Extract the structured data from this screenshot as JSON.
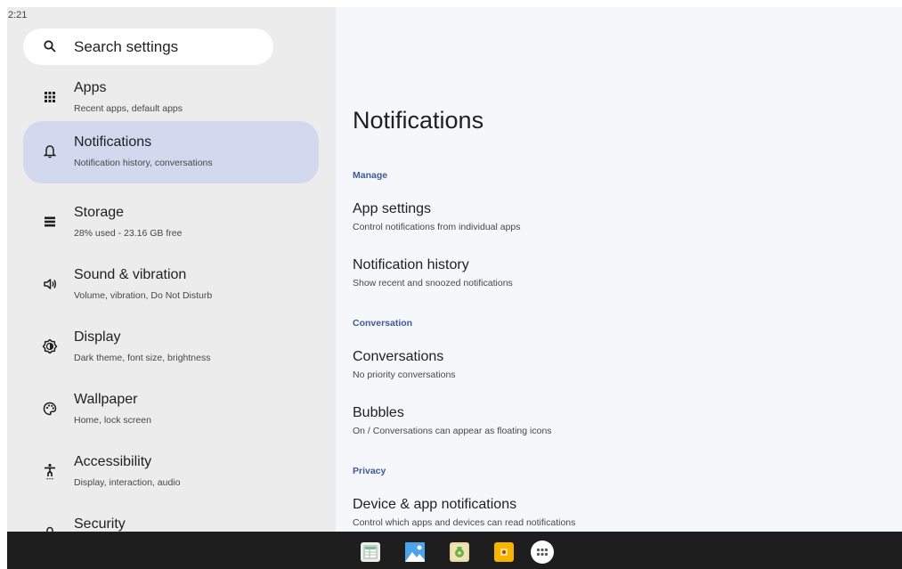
{
  "status_bar": {
    "time": "2:21"
  },
  "search": {
    "label": "Search settings",
    "icon": "search-icon"
  },
  "sidebar": {
    "items": [
      {
        "title": "Apps",
        "subtitle": "Recent apps, default apps",
        "icon": "apps-grid-icon"
      },
      {
        "title": "Notifications",
        "subtitle": "Notification history, conversations",
        "icon": "bell-icon",
        "selected": true
      },
      {
        "title": "Storage",
        "subtitle": "28% used - 23.16 GB free",
        "icon": "storage-icon"
      },
      {
        "title": "Sound & vibration",
        "subtitle": "Volume, vibration, Do Not Disturb",
        "icon": "speaker-icon"
      },
      {
        "title": "Display",
        "subtitle": "Dark theme, font size, brightness",
        "icon": "brightness-icon"
      },
      {
        "title": "Wallpaper",
        "subtitle": "Home, lock screen",
        "icon": "palette-icon"
      },
      {
        "title": "Accessibility",
        "subtitle": "Display, interaction, audio",
        "icon": "accessibility-icon"
      },
      {
        "title": "Security",
        "subtitle": "",
        "icon": "lock-icon"
      }
    ]
  },
  "page": {
    "title": "Notifications",
    "sections": {
      "manage": "Manage",
      "conversation": "Conversation",
      "privacy": "Privacy"
    },
    "items": {
      "app_settings": {
        "title": "App settings",
        "subtitle": "Control notifications from individual apps"
      },
      "notification_history": {
        "title": "Notification history",
        "subtitle": "Show recent and snoozed notifications"
      },
      "conversations": {
        "title": "Conversations",
        "subtitle": "No priority conversations"
      },
      "bubbles": {
        "title": "Bubbles",
        "subtitle": "On / Conversations can appear as floating icons"
      },
      "device_app_notifications": {
        "title": "Device & app notifications",
        "subtitle": "Control which apps and devices can read notifications"
      }
    }
  },
  "taskbar": {
    "apps": [
      "sheets-app-icon",
      "gallery-app-icon",
      "android-app-icon",
      "files-app-icon",
      "app-drawer-icon"
    ]
  },
  "colors": {
    "sidebar_bg": "#ececed",
    "selected_bg": "#d2d9ee",
    "content_bg": "#f6f7fa",
    "section_header": "#3c5a99",
    "taskbar_bg": "#1e1e1e"
  }
}
